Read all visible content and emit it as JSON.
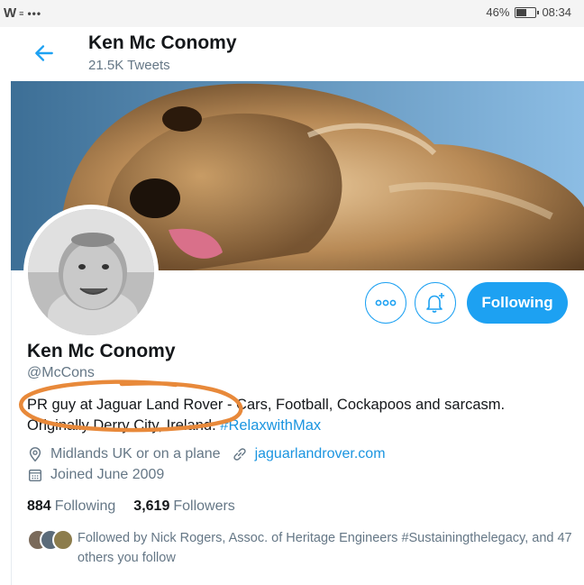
{
  "status_bar": {
    "battery": "46%",
    "time": "08:34",
    "battery_level": 0.46
  },
  "header": {
    "title": "Ken Mc Conomy",
    "tweets": "21.5K Tweets"
  },
  "profile": {
    "name": "Ken Mc Conomy",
    "handle": "@McCons",
    "bio_text": "PR guy at Jaguar Land Rover - Cars, Football, Cockapoos and sarcasm. Originally Derry City, Ireland. ",
    "bio_hashtag": "#RelaxwithMax",
    "location": "Midlands UK or on a plane",
    "website": "jaguarlandrover.com",
    "joined": "Joined June 2009"
  },
  "buttons": {
    "following": "Following"
  },
  "counts": {
    "following_count": "884",
    "following_label": "Following",
    "followers_count": "3,619",
    "followers_label": "Followers"
  },
  "followed_by": "Followed by Nick Rogers, Assoc. of Heritage Engineers #Sustainingthelegacy, and 47 others you follow",
  "icons": [
    "back-arrow-icon",
    "more-options-icon",
    "bell-plus-icon",
    "location-pin-icon",
    "link-icon",
    "calendar-icon"
  ],
  "colors": {
    "accent": "#1da1f2",
    "link": "#1b95e0",
    "muted": "#657786",
    "annotation": "#e8893a"
  }
}
